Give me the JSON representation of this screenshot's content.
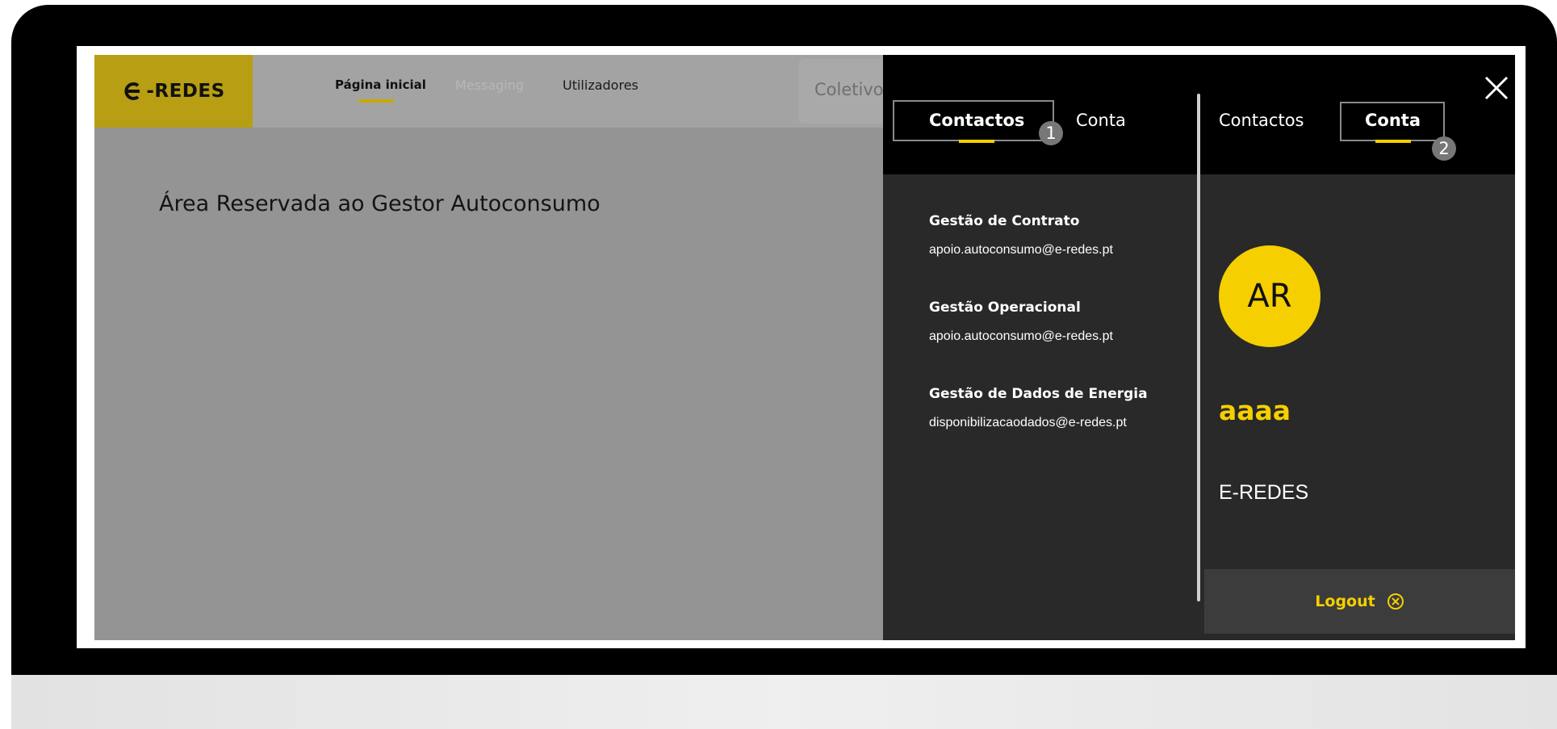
{
  "header": {
    "brand": "-REDES",
    "nav": {
      "home": "Página inicial",
      "messaging": "Messaging",
      "users": "Utilizadores"
    },
    "search_text": "Coletivo"
  },
  "main": {
    "title": "Área Reservada ao Gestor Autoconsumo"
  },
  "drawer": {
    "left_tabs": {
      "contacts": "Contactos",
      "account": "Conta"
    },
    "right_tabs": {
      "contacts": "Contactos",
      "account": "Conta"
    },
    "badges": {
      "first": "1",
      "second": "2"
    },
    "contacts": [
      {
        "title": "Gestão de Contrato",
        "email": "apoio.autoconsumo@e-redes.pt"
      },
      {
        "title": "Gestão Operacional",
        "email": "apoio.autoconsumo@e-redes.pt"
      },
      {
        "title": "Gestão de Dados de Energia",
        "email": "disponibilizacaodados@e-redes.pt"
      }
    ],
    "account": {
      "initials": "AR",
      "name": "aaaa",
      "organization": "E-REDES",
      "logout": "Logout"
    }
  },
  "colors": {
    "brand_yellow": "#f5cf00",
    "logo_background": "#b89e12",
    "drawer_background": "#292929"
  },
  "icons": [
    "logo-icon",
    "close-icon",
    "logout-icon"
  ]
}
